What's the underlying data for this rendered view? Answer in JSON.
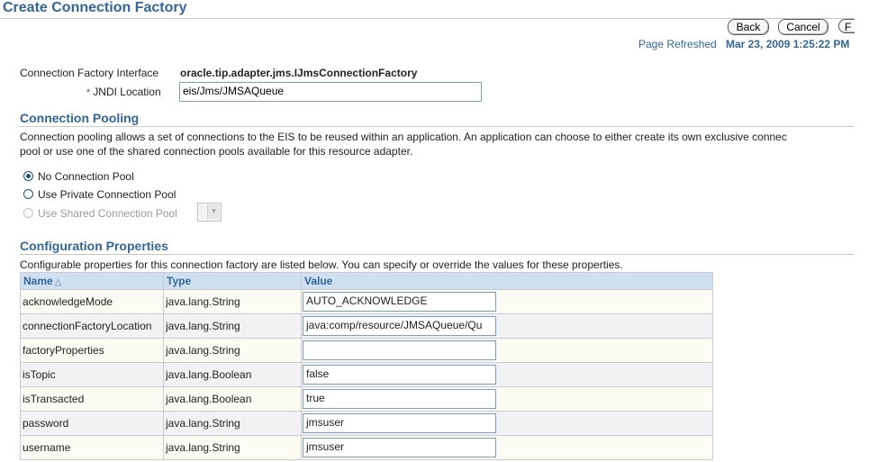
{
  "page": {
    "title": "Create Connection Factory",
    "buttons": {
      "back": "Back",
      "cancel": "Cancel",
      "finish": "F"
    },
    "refreshed_label": "Page Refreshed",
    "refreshed_value": "Mar 23, 2009 1:25:22 PM"
  },
  "form": {
    "cf_interface_label": "Connection Factory Interface",
    "cf_interface_value": "oracle.tip.adapter.jms.IJmsConnectionFactory",
    "jndi_required_mark": "*",
    "jndi_label": "JNDI Location",
    "jndi_value": "eis/Jms/JMSAQueue"
  },
  "pooling": {
    "title": "Connection Pooling",
    "description_line1": "Connection pooling allows a set of connections to the EIS to be reused within an application. An application can choose to either create its own exclusive connec",
    "description_line2": "pool or use one of the shared connection pools available for this resource adapter.",
    "options": [
      {
        "label": "No Connection Pool",
        "checked": true,
        "disabled": false
      },
      {
        "label": "Use Private Connection Pool",
        "checked": false,
        "disabled": false
      },
      {
        "label": "Use Shared Connection Pool",
        "checked": false,
        "disabled": true
      }
    ]
  },
  "config": {
    "title": "Configuration Properties",
    "description": "Configurable properties for this connection factory are listed below. You can specify or override the values for these properties.",
    "headers": {
      "name": "Name",
      "type": "Type",
      "value": "Value"
    },
    "rows": [
      {
        "name": "acknowledgeMode",
        "type": "java.lang.String",
        "value": "AUTO_ACKNOWLEDGE"
      },
      {
        "name": "connectionFactoryLocation",
        "type": "java.lang.String",
        "value": "java:comp/resource/JMSAQueue/Qu"
      },
      {
        "name": "factoryProperties",
        "type": "java.lang.String",
        "value": ""
      },
      {
        "name": "isTopic",
        "type": "java.lang.Boolean",
        "value": "false"
      },
      {
        "name": "isTransacted",
        "type": "java.lang.Boolean",
        "value": "true"
      },
      {
        "name": "password",
        "type": "java.lang.String",
        "value": "jmsuser"
      },
      {
        "name": "username",
        "type": "java.lang.String",
        "value": "jmsuser"
      }
    ]
  }
}
